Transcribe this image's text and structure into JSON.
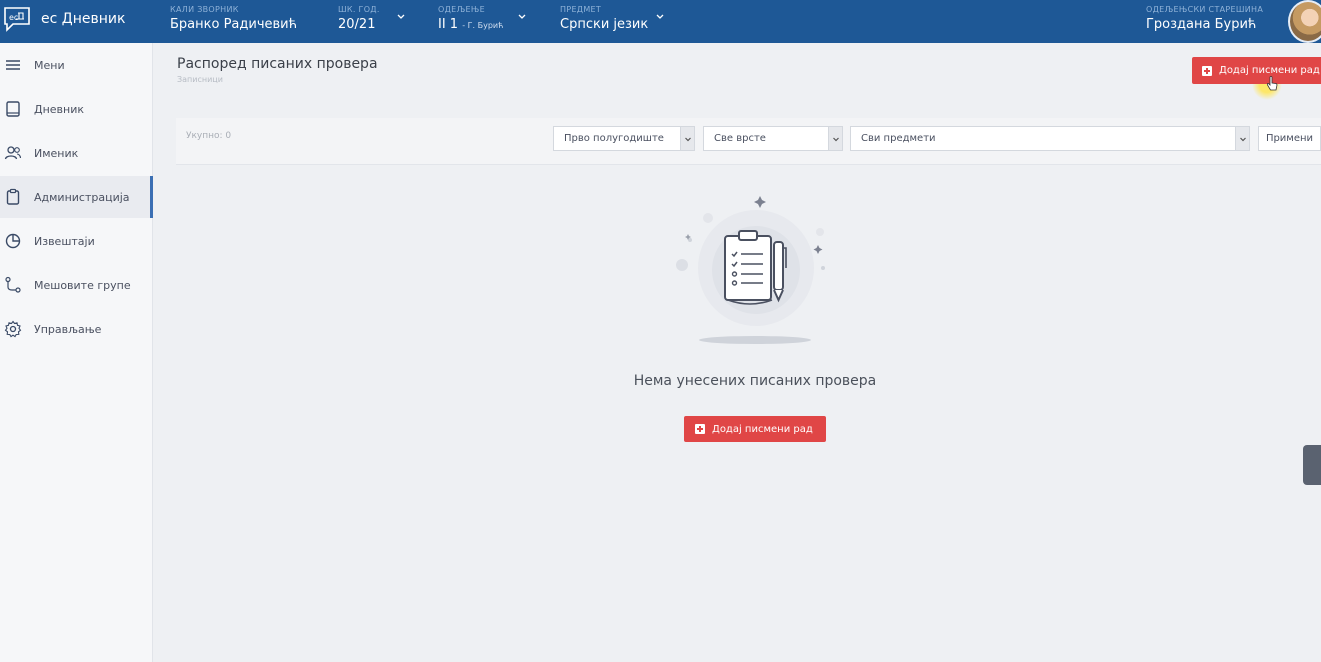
{
  "app": {
    "name": "ес Дневник"
  },
  "header": {
    "user_label": "КАЛИ ЗВОРНИК",
    "user_value": "Бранко Радичевић",
    "year_label": "ШК. ГОД.",
    "year_value": "20/21",
    "class_label": "ОДЕЉЕЊЕ",
    "class_value": "II 1",
    "class_extra": "- Г. Бурић",
    "subject_label": "ПРЕДМЕТ",
    "subject_value": "Српски језик",
    "teacher_label": "ОДЕЉЕЊСКИ СТАРЕШИНА",
    "teacher_value": "Гроздана Бурић"
  },
  "sidebar": {
    "items": [
      {
        "label": "Мени",
        "icon": "menu-icon"
      },
      {
        "label": "Дневник",
        "icon": "book-icon"
      },
      {
        "label": "Именик",
        "icon": "users-icon"
      },
      {
        "label": "Администрација",
        "icon": "clipboard-icon"
      },
      {
        "label": "Извештаји",
        "icon": "pie-chart-icon"
      },
      {
        "label": "Мешовите групе",
        "icon": "share-nodes-icon"
      },
      {
        "label": "Управљање",
        "icon": "gear-icon"
      }
    ]
  },
  "page": {
    "title": "Распоред писаних провера",
    "subtitle": "Записници",
    "add_button": "Додај писмени рад"
  },
  "filters": {
    "total": "Укупно: 0",
    "semester": "Прво полугодиште",
    "type": "Све врсте",
    "subject": "Сви предмети",
    "apply": "Примени"
  },
  "empty": {
    "message": "Нема унесених писаних провера",
    "button": "Додај писмени рад"
  },
  "colors": {
    "header": "#1e5896",
    "accent_red": "#e04646",
    "active_border": "#3b6fb3"
  }
}
